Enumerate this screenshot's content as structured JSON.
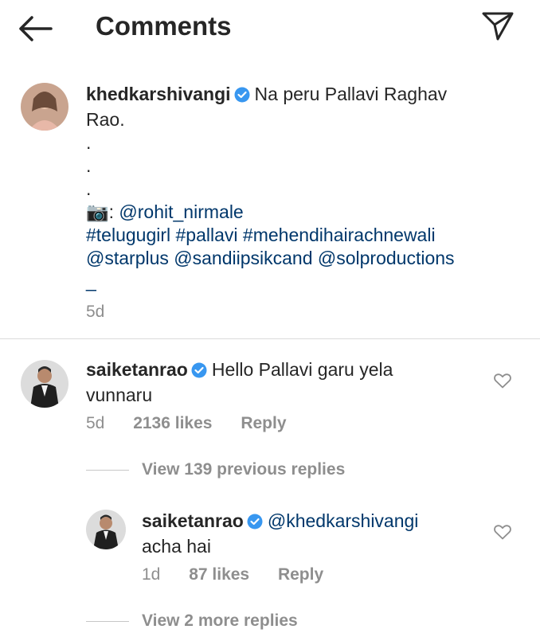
{
  "header": {
    "title": "Comments"
  },
  "caption": {
    "username": "khedkarshivangi",
    "text_line1": "Na peru Pallavi Raghav",
    "text_line2": "Rao.",
    "dot": ".",
    "camera_emoji": "📷",
    "credit_prefix": ": ",
    "credit_handle": "@rohit_nirmale",
    "hashtags": "#telugugirl #pallavi #mehendihairachnewali",
    "mentions": "@starplus @sandiipsikcand @solproductions",
    "trailing": "_",
    "time": "5d"
  },
  "comments": [
    {
      "username": "saiketanrao",
      "text_line1": "Hello Pallavi garu yela",
      "text_line2": "vunnaru",
      "time": "5d",
      "likes": "2136 likes",
      "reply_label": "Reply",
      "view_previous": "View 139 previous replies"
    }
  ],
  "replies": [
    {
      "username": "saiketanrao",
      "mention": "@khedkarshivangi",
      "text_line2": "acha hai",
      "time": "1d",
      "likes": "87 likes",
      "reply_label": "Reply",
      "view_more": "View 2 more replies"
    }
  ],
  "colors": {
    "verified": "#3897f0",
    "link": "#00376b",
    "muted": "#8e8e8e"
  }
}
